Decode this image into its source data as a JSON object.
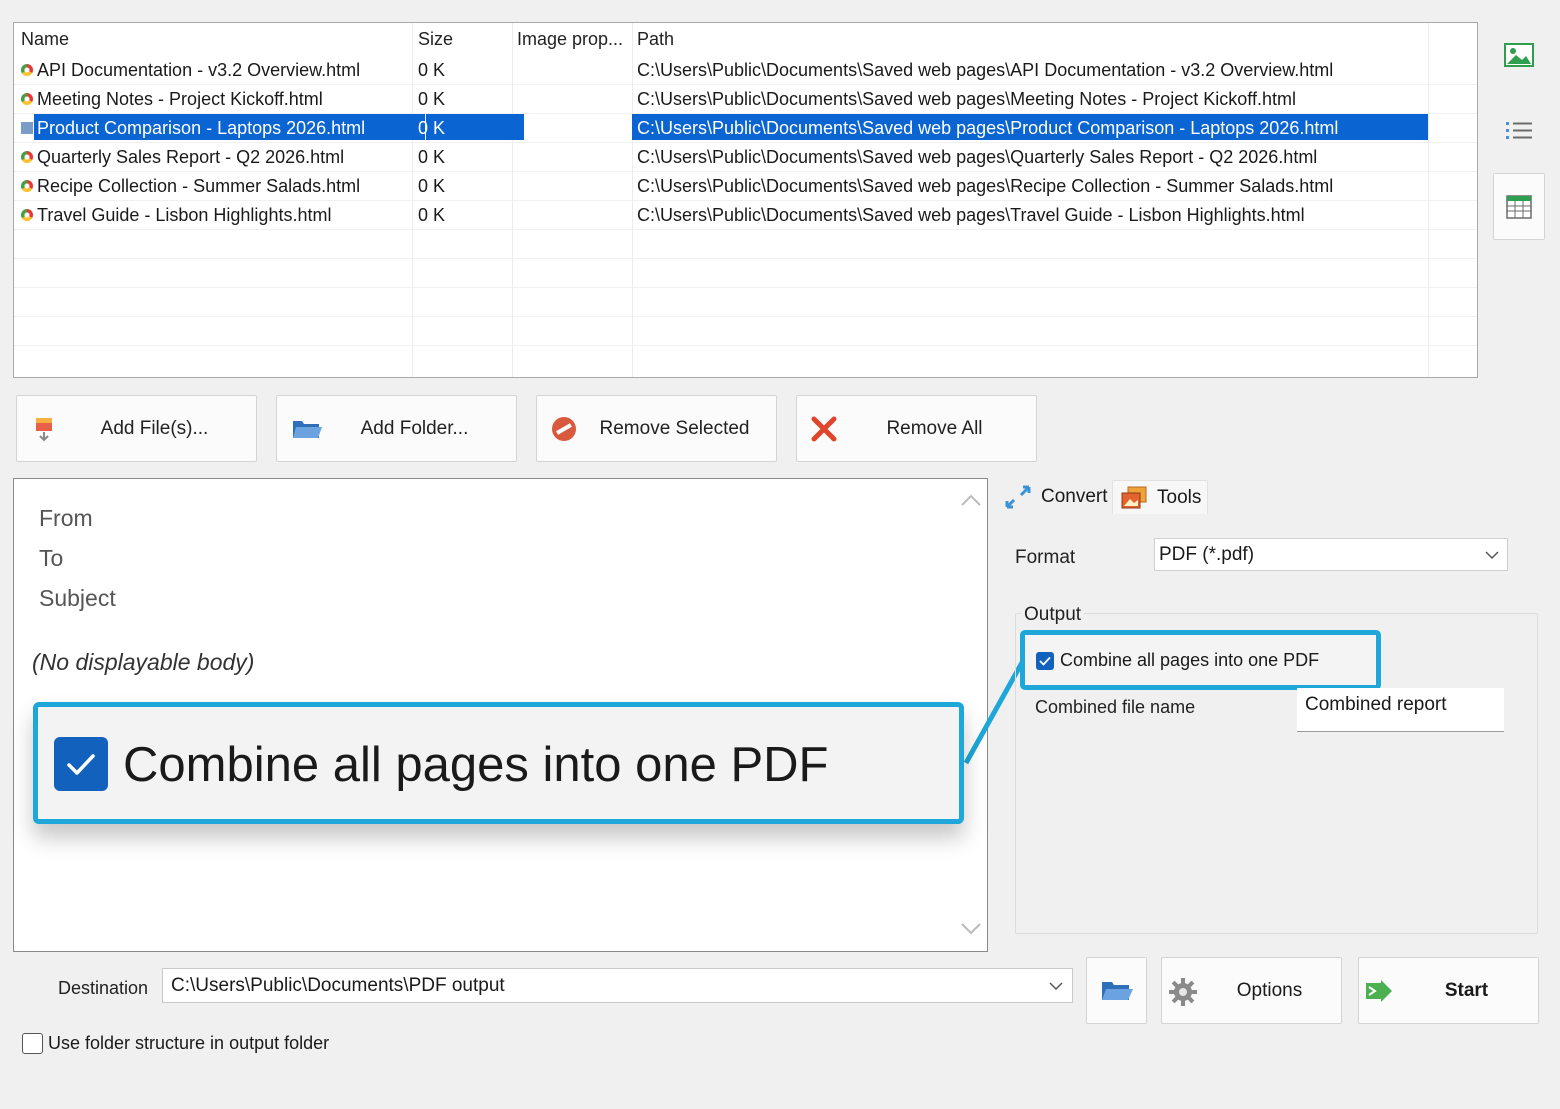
{
  "file_list": {
    "columns": [
      "Name",
      "Size",
      "Image prop...",
      "Path"
    ],
    "rows": [
      {
        "name": "API Documentation - v3.2 Overview.html",
        "size": "0 K",
        "image": "",
        "path": "C:\\Users\\Public\\Documents\\Saved web pages\\API Documentation - v3.2 Overview.html"
      },
      {
        "name": "Meeting Notes - Project Kickoff.html",
        "size": "0 K",
        "image": "",
        "path": "C:\\Users\\Public\\Documents\\Saved web pages\\Meeting Notes - Project Kickoff.html"
      },
      {
        "name": "Product Comparison - Laptops 2026.html",
        "size": "0 K",
        "image": "",
        "path": "C:\\Users\\Public\\Documents\\Saved web pages\\Product Comparison - Laptops 2026.html"
      },
      {
        "name": "Quarterly Sales Report - Q2 2026.html",
        "size": "0 K",
        "image": "",
        "path": "C:\\Users\\Public\\Documents\\Saved web pages\\Quarterly Sales Report - Q2 2026.html"
      },
      {
        "name": "Recipe Collection - Summer Salads.html",
        "size": "0 K",
        "image": "",
        "path": "C:\\Users\\Public\\Documents\\Saved web pages\\Recipe Collection - Summer Salads.html"
      },
      {
        "name": "Travel Guide - Lisbon Highlights.html",
        "size": "0 K",
        "image": "",
        "path": "C:\\Users\\Public\\Documents\\Saved web pages\\Travel Guide - Lisbon Highlights.html"
      }
    ],
    "selected_index": 2
  },
  "view_icons": [
    "image-view-icon",
    "list-view-icon",
    "table-view-icon"
  ],
  "buttons": {
    "add_files": "Add File(s)...",
    "add_folder": "Add Folder...",
    "remove_selected": "Remove Selected",
    "remove_all": "Remove All"
  },
  "preview": {
    "from": "From",
    "to": "To",
    "subject": "Subject",
    "body": "(No displayable body)"
  },
  "callout": {
    "text": "Combine all pages into one PDF"
  },
  "tabs": {
    "convert": "Convert",
    "tools": "Tools"
  },
  "convert": {
    "format_label": "Format",
    "format_value": "PDF (*.pdf)",
    "output_label": "Output",
    "combine_label": "Combine all pages into one PDF",
    "combine_checked": true,
    "combined_name_label": "Combined file name",
    "combined_name_value": "Combined report"
  },
  "bottom": {
    "destination_label": "Destination",
    "destination_value": "C:\\Users\\Public\\Documents\\PDF output",
    "options": "Options",
    "start": "Start",
    "folder_structure_label": "Use folder structure in output folder",
    "folder_structure_checked": false
  },
  "colors": {
    "selection": "#0a64d2",
    "highlight": "#1ea7d8",
    "checkbox": "#1262bd"
  }
}
